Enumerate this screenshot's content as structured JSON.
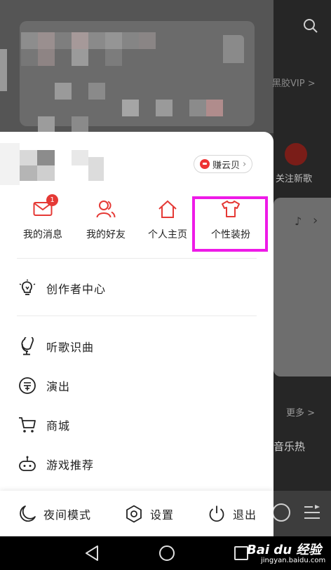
{
  "background": {
    "vip_text": "黑胶VIP >",
    "follow_text": "关注新歌",
    "more_text": "更多 >",
    "hot_text": "音乐热"
  },
  "drawer": {
    "coin_badge": "赚云贝",
    "quick_actions": [
      {
        "label": "我的消息",
        "icon": "envelope-icon",
        "badge": "1"
      },
      {
        "label": "我的好友",
        "icon": "friends-icon"
      },
      {
        "label": "个人主页",
        "icon": "home-icon"
      },
      {
        "label": "个性装扮",
        "icon": "tshirt-icon"
      }
    ],
    "creator_center": "创作者中心",
    "menu": [
      {
        "label": "听歌识曲",
        "icon": "microphone-icon"
      },
      {
        "label": "演出",
        "icon": "ticket-icon"
      },
      {
        "label": "商城",
        "icon": "cart-icon"
      },
      {
        "label": "游戏推荐",
        "icon": "gamepad-icon"
      }
    ],
    "bottom_bar": {
      "night_mode": "夜间模式",
      "settings": "设置",
      "logout": "退出"
    }
  },
  "watermark": {
    "main": "Bai du 经验",
    "sub": "jingyan.baidu.com"
  },
  "colors": {
    "accent_red": "#e53935",
    "highlight_magenta": "#ee1ae7"
  }
}
